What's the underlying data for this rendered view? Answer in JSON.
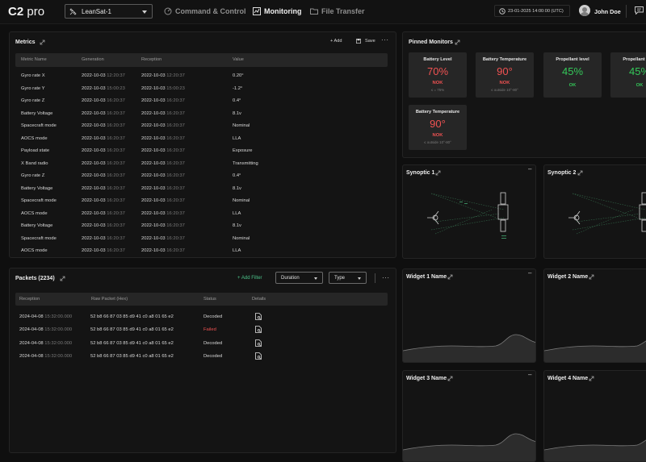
{
  "header": {
    "logo_bold": "C2",
    "logo_light": " pro",
    "satellite": "LeanSat-1",
    "nav": [
      {
        "label": "Command & Control",
        "icon": "command-icon"
      },
      {
        "label": "Monitoring",
        "icon": "chart-icon"
      },
      {
        "label": "File Transfer",
        "icon": "folder-icon"
      }
    ],
    "clock": "23-01-2025 14:00:00 (UTC)",
    "user": "John Doe"
  },
  "metrics": {
    "title": "Metrics",
    "add_label": "Add",
    "save_label": "Save",
    "columns": [
      "Metric Name",
      "Generation",
      "Reception",
      "Value"
    ],
    "rows": [
      {
        "name": "Gyro rate X",
        "gen_date": "2022-10-03",
        "gen_time": "12:20:37",
        "rec_date": "2022-10-03",
        "rec_time": "12:20:37",
        "value": "0.20°"
      },
      {
        "name": "Gyro rate Y",
        "gen_date": "2022-10-03",
        "gen_time": "15:00:23",
        "rec_date": "2022-10-03",
        "rec_time": "15:00:23",
        "value": "-1.2°"
      },
      {
        "name": "Gyro rate Z",
        "gen_date": "2022-10-03",
        "gen_time": "16:20:37",
        "rec_date": "2022-10-03",
        "rec_time": "16:20:37",
        "value": "0.4°"
      },
      {
        "name": "Battery Voltage",
        "gen_date": "2022-10-03",
        "gen_time": "16:20:37",
        "rec_date": "2022-10-03",
        "rec_time": "16:20:37",
        "value": "8.1v"
      },
      {
        "name": "Spacecraft mode",
        "gen_date": "2022-10-03",
        "gen_time": "16:20:37",
        "rec_date": "2022-10-03",
        "rec_time": "16:20:37",
        "value": "Nominal"
      },
      {
        "name": "AOCS mode",
        "gen_date": "2022-10-03",
        "gen_time": "16:20:37",
        "rec_date": "2022-10-03",
        "rec_time": "16:20:37",
        "value": "LLA"
      },
      {
        "name": "Payload state",
        "gen_date": "2022-10-03",
        "gen_time": "16:20:37",
        "rec_date": "2022-10-03",
        "rec_time": "16:20:37",
        "value": "Exposure"
      },
      {
        "name": "X Band radio",
        "gen_date": "2022-10-03",
        "gen_time": "16:20:37",
        "rec_date": "2022-10-03",
        "rec_time": "16:20:37",
        "value": "Transmitting"
      },
      {
        "name": "Gyro rate Z",
        "gen_date": "2022-10-03",
        "gen_time": "16:20:37",
        "rec_date": "2022-10-03",
        "rec_time": "16:20:37",
        "value": "0.4°"
      },
      {
        "name": "Battery Voltage",
        "gen_date": "2022-10-03",
        "gen_time": "16:20:37",
        "rec_date": "2022-10-03",
        "rec_time": "16:20:37",
        "value": "8.1v"
      },
      {
        "name": "Spacecraft mode",
        "gen_date": "2022-10-03",
        "gen_time": "16:20:37",
        "rec_date": "2022-10-03",
        "rec_time": "16:20:37",
        "value": "Nominal"
      },
      {
        "name": "AOCS mode",
        "gen_date": "2022-10-03",
        "gen_time": "16:20:37",
        "rec_date": "2022-10-03",
        "rec_time": "16:20:37",
        "value": "LLA"
      },
      {
        "name": "Battery Voltage",
        "gen_date": "2022-10-03",
        "gen_time": "16:20:37",
        "rec_date": "2022-10-03",
        "rec_time": "16:20:37",
        "value": "8.1v"
      },
      {
        "name": "Spacecraft mode",
        "gen_date": "2022-10-03",
        "gen_time": "16:20:37",
        "rec_date": "2022-10-03",
        "rec_time": "16:20:37",
        "value": "Nominal"
      },
      {
        "name": "AOCS mode",
        "gen_date": "2022-10-03",
        "gen_time": "16:20:37",
        "rec_date": "2022-10-03",
        "rec_time": "16:20:37",
        "value": "LLA"
      }
    ]
  },
  "pinned": {
    "title": "Pinned Monitors",
    "cards": [
      {
        "title": "Battery Level",
        "value": "70%",
        "status": "NOK",
        "sub": "≤ = 75%",
        "state": "nok"
      },
      {
        "title": "Battery Temperature",
        "value": "90°",
        "status": "NOK",
        "sub": "≤ outside 10°-80°",
        "state": "nok"
      },
      {
        "title": "Propellant level",
        "value": "45%",
        "status": "OK",
        "sub": "",
        "state": "ok"
      },
      {
        "title": "Propellant level",
        "value": "45%",
        "status": "OK",
        "sub": "",
        "state": "ok"
      },
      {
        "title": "Battery Temperature",
        "value": "90°",
        "status": "NOK",
        "sub": "≤ outside 10°-80°",
        "state": "nok"
      }
    ]
  },
  "packets": {
    "title": "Packets (2234)",
    "add_filter": "Add Filter",
    "duration": "Duration",
    "type": "Type",
    "columns": [
      "Reception",
      "Raw Packet (Hex)",
      "Status",
      "Details"
    ],
    "rows": [
      {
        "date": "2024-04-08",
        "time": "15:32:00.000",
        "raw": "52 b8 66 87 03 85 d9 41 c0 a8 01 65 e2",
        "status": "Decoded"
      },
      {
        "date": "2024-04-08",
        "time": "15:32:00.000",
        "raw": "52 b8 66 87 03 85 d9 41 c0 a8 01 65 e2",
        "status": "Failed"
      },
      {
        "date": "2024-04-08",
        "time": "15:32:00.000",
        "raw": "52 b8 66 87 03 85 d9 41 c0 a8 01 65 e2",
        "status": "Decoded"
      },
      {
        "date": "2024-04-08",
        "time": "15:32:00.000",
        "raw": "52 b8 66 87 03 85 d9 41 c0 a8 01 65 e2",
        "status": "Decoded"
      }
    ]
  },
  "synoptics": [
    {
      "title": "Synoptic 1"
    },
    {
      "title": "Synoptic 2"
    }
  ],
  "widgets": [
    {
      "title": "Widget 1 Name"
    },
    {
      "title": "Widget 2 Name"
    },
    {
      "title": "Widget 3 Name"
    },
    {
      "title": "Widget 4 Name"
    }
  ],
  "colors": {
    "background": "#0f0f0f",
    "panel": "#141414",
    "nok": "#f05252",
    "ok": "#34c759",
    "accent": "#4cc38a"
  }
}
